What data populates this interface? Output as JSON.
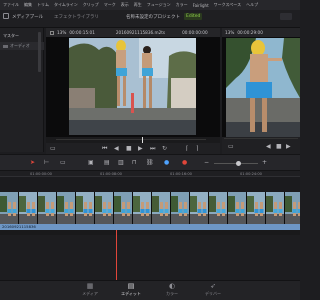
{
  "menu": [
    "ファイル",
    "編集",
    "トリム",
    "タイムライン",
    "クリップ",
    "マーク",
    "表示",
    "再生",
    "フュージョン",
    "カラー",
    "Fairlight",
    "ワークスペース",
    "ヘルプ"
  ],
  "header": {
    "left_tab": "メディアプール",
    "right_tab": "エフェクトライブラリ",
    "project": "名称未設定のプロジェクト",
    "status": "Edited"
  },
  "media_pool": {
    "title": "マスター",
    "bin": "オーディオ"
  },
  "source_viewer": {
    "zoom": "13%",
    "timecode": "00:00:15:01",
    "clip_name": "20160921115836.m2ts",
    "tc_right": "00:00:00:00"
  },
  "timeline_viewer": {
    "zoom": "13%",
    "timecode": "00:00:29:00"
  },
  "timeline": {
    "ruler_labels": [
      "01:00:00:00",
      "01:00:08:00",
      "01:00:16:00",
      "01:00:24:00"
    ],
    "clip_name": "20160921115836"
  },
  "pages": [
    {
      "label": "メディア",
      "icon": "media-icon",
      "active": false
    },
    {
      "label": "エディット",
      "icon": "edit-icon",
      "active": true
    },
    {
      "label": "カラー",
      "icon": "color-icon",
      "active": false
    },
    {
      "label": "デリバー",
      "icon": "deliver-icon",
      "active": false
    }
  ],
  "colors": {
    "accent_red": "#e0463a",
    "accent_blue": "#4fa3ff",
    "clip_blue": "#6e97c6",
    "status_green": "#8fd04a"
  }
}
